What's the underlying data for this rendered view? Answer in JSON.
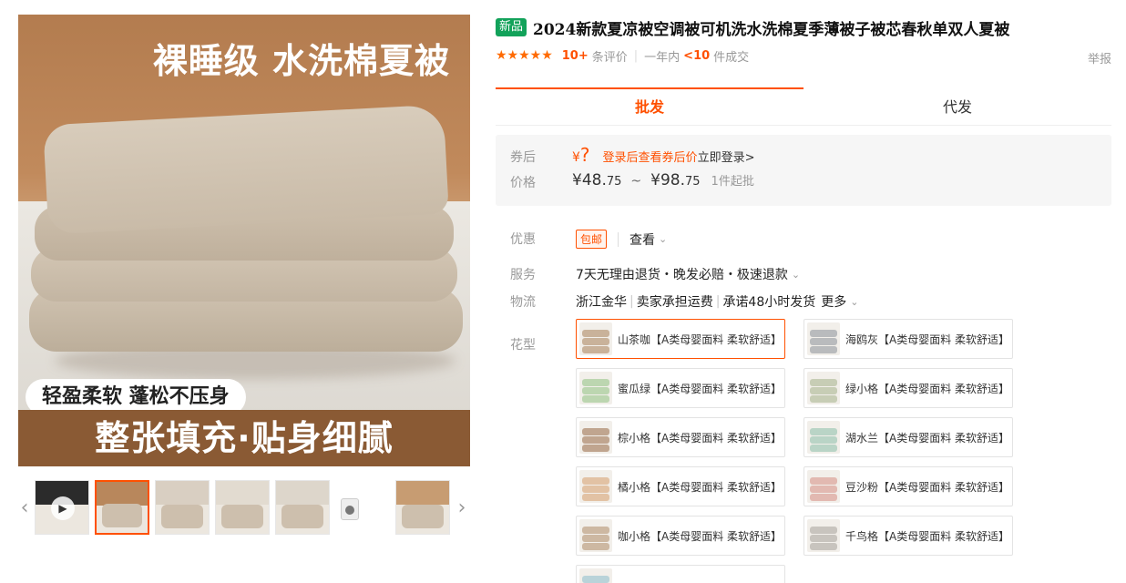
{
  "gallery": {
    "headline": "裸睡级 水洗棉夏被",
    "soft_tag": "轻盈柔软 蓬松不压身",
    "bottom_banner": "整张填充·贴身细腻",
    "prev_arrow": "‹",
    "next_arrow": "›",
    "play_glyph": "▶",
    "thumbs": [
      {
        "kind": "video",
        "bg": "#2b2b2b"
      },
      {
        "kind": "image",
        "bg": "#b8875c",
        "active": true
      },
      {
        "kind": "image",
        "bg": "#d9cfc2"
      },
      {
        "kind": "image",
        "bg": "#e2dbd0"
      },
      {
        "kind": "image",
        "bg": "#ddd6cb"
      },
      {
        "kind": "washer"
      },
      {
        "kind": "image",
        "bg": "#c79c72"
      }
    ]
  },
  "product": {
    "new_badge": "新品",
    "title": "2024新款夏凉被空调被可机洗水洗棉夏季薄被子被芯春秋单双人夏被",
    "stars": "★★★★★",
    "review_count": "10+",
    "review_label": "条评价",
    "sold_prefix": "一年内",
    "sold_count": "<10",
    "sold_suffix": "件成交",
    "report": "举报"
  },
  "tabs": [
    {
      "label": "批发",
      "active": true
    },
    {
      "label": "代发",
      "active": false
    }
  ],
  "price": {
    "coupon_label": "券后",
    "coupon_yen": "¥",
    "coupon_value": "?",
    "login_tip": "登录后查看券后价",
    "login_link": "立即登录>",
    "price_label": "价格",
    "low_int": "¥48.",
    "low_dec": "75",
    "tilde": "~",
    "high_int": "¥98.",
    "high_dec": "75",
    "moq": "1件起批"
  },
  "rows": {
    "promo_label": "优惠",
    "promo_pill": "包邮",
    "promo_view": "查看",
    "service_label": "服务",
    "service_value": "7天无理由退货・晚发必赔・极速退款",
    "logistics_label": "物流",
    "logistics_origin": "浙江金华",
    "logistics_fee": "卖家承担运费",
    "logistics_ship": "承诺48小时发货",
    "logistics_more": "更多",
    "pattern_label": "花型",
    "chevron": "⌄"
  },
  "swatches": [
    {
      "label": "山茶咖【A类母婴面料 柔软舒适】",
      "color": "#c9b29a",
      "selected": true
    },
    {
      "label": "海鸥灰【A类母婴面料 柔软舒适】",
      "color": "#b9bbbd",
      "selected": false
    },
    {
      "label": "蜜瓜绿【A类母婴面料 柔软舒适】",
      "color": "#bcd6b0",
      "selected": false
    },
    {
      "label": "绿小格【A类母婴面料 柔软舒适】",
      "color": "#c7cdb5",
      "selected": false
    },
    {
      "label": "棕小格【A类母婴面料 柔软舒适】",
      "color": "#c0a58f",
      "selected": false
    },
    {
      "label": "湖水兰【A类母婴面料 柔软舒适】",
      "color": "#b9d4c6",
      "selected": false
    },
    {
      "label": "橘小格【A类母婴面料 柔软舒适】",
      "color": "#e2c2a4",
      "selected": false
    },
    {
      "label": "豆沙粉【A类母婴面料 柔软舒适】",
      "color": "#e2b9b1",
      "selected": false
    },
    {
      "label": "咖小格【A类母婴面料 柔软舒适】",
      "color": "#cdb8a2",
      "selected": false
    },
    {
      "label": "千鸟格【A类母婴面料 柔软舒适】",
      "color": "#c8c4be",
      "selected": false
    },
    {
      "label": "",
      "color": "#b9d3d9",
      "selected": false
    }
  ]
}
